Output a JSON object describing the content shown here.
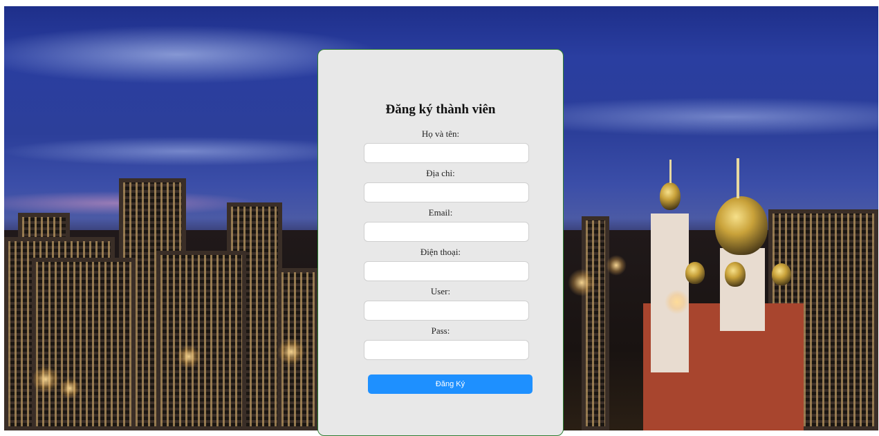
{
  "form": {
    "title": "Đăng ký thành viên",
    "fields": [
      {
        "label": "Họ và tên:",
        "value": ""
      },
      {
        "label": "Địa chỉ:",
        "value": ""
      },
      {
        "label": "Email:",
        "value": ""
      },
      {
        "label": "Điện thoại:",
        "value": ""
      },
      {
        "label": "User:",
        "value": ""
      },
      {
        "label": "Pass:",
        "value": ""
      }
    ],
    "submit_label": "Đăng Ký"
  },
  "colors": {
    "card_background": "#e8e8e8",
    "card_border": "#2e7d32",
    "button": "#1e90ff"
  }
}
